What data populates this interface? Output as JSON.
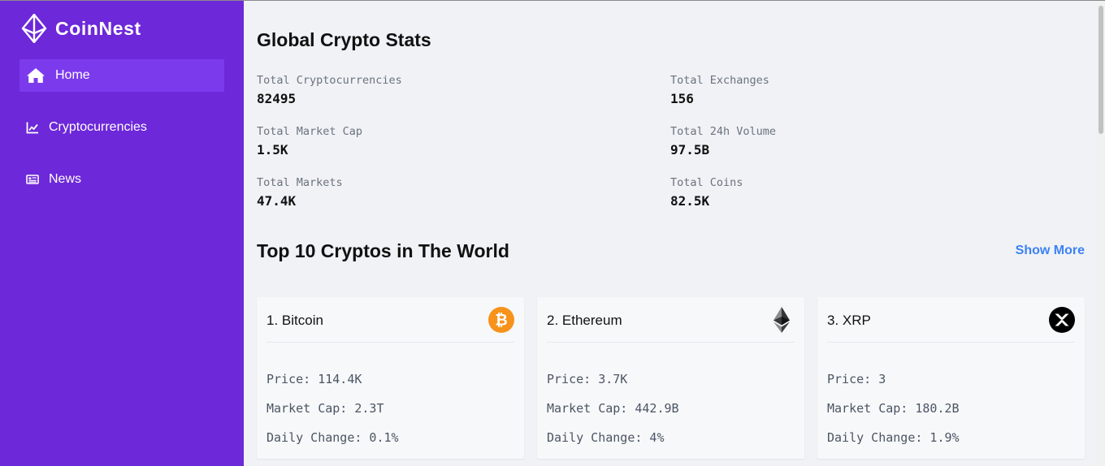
{
  "brand": {
    "name": "CoinNest",
    "icon": "ethereum-diamond-logo"
  },
  "sidebar": {
    "items": [
      {
        "label": "Home",
        "icon": "home-icon",
        "active": true
      },
      {
        "label": "Cryptocurrencies",
        "icon": "chart-line-icon",
        "active": false
      },
      {
        "label": "News",
        "icon": "newspaper-icon",
        "active": false
      }
    ]
  },
  "main": {
    "title": "Global Crypto Stats",
    "stats": [
      {
        "label": "Total Cryptocurrencies",
        "value": "82495"
      },
      {
        "label": "Total Exchanges",
        "value": "156"
      },
      {
        "label": "Total Market Cap",
        "value": "1.5K"
      },
      {
        "label": "Total 24h Volume",
        "value": "97.5B"
      },
      {
        "label": "Total Markets",
        "value": "47.4K"
      },
      {
        "label": "Total Coins",
        "value": "82.5K"
      }
    ],
    "top_section": {
      "title": "Top 10 Cryptos in The World",
      "show_more": "Show More"
    },
    "cards": [
      {
        "name": "1. Bitcoin",
        "icon": "bitcoin-icon",
        "price": "Price: 114.4K",
        "market_cap": "Market Cap: 2.3T",
        "daily_change": "Daily Change: 0.1%"
      },
      {
        "name": "2. Ethereum",
        "icon": "ethereum-icon",
        "price": "Price: 3.7K",
        "market_cap": "Market Cap: 442.9B",
        "daily_change": "Daily Change: 4%"
      },
      {
        "name": "3. XRP",
        "icon": "xrp-icon",
        "price": "Price: 3",
        "market_cap": "Market Cap: 180.2B",
        "daily_change": "Daily Change: 1.9%"
      }
    ]
  },
  "colors": {
    "sidebar_bg": "#6d28d9",
    "sidebar_active": "#7c3aed",
    "link": "#3b82f6",
    "bitcoin": "#f7931a"
  }
}
